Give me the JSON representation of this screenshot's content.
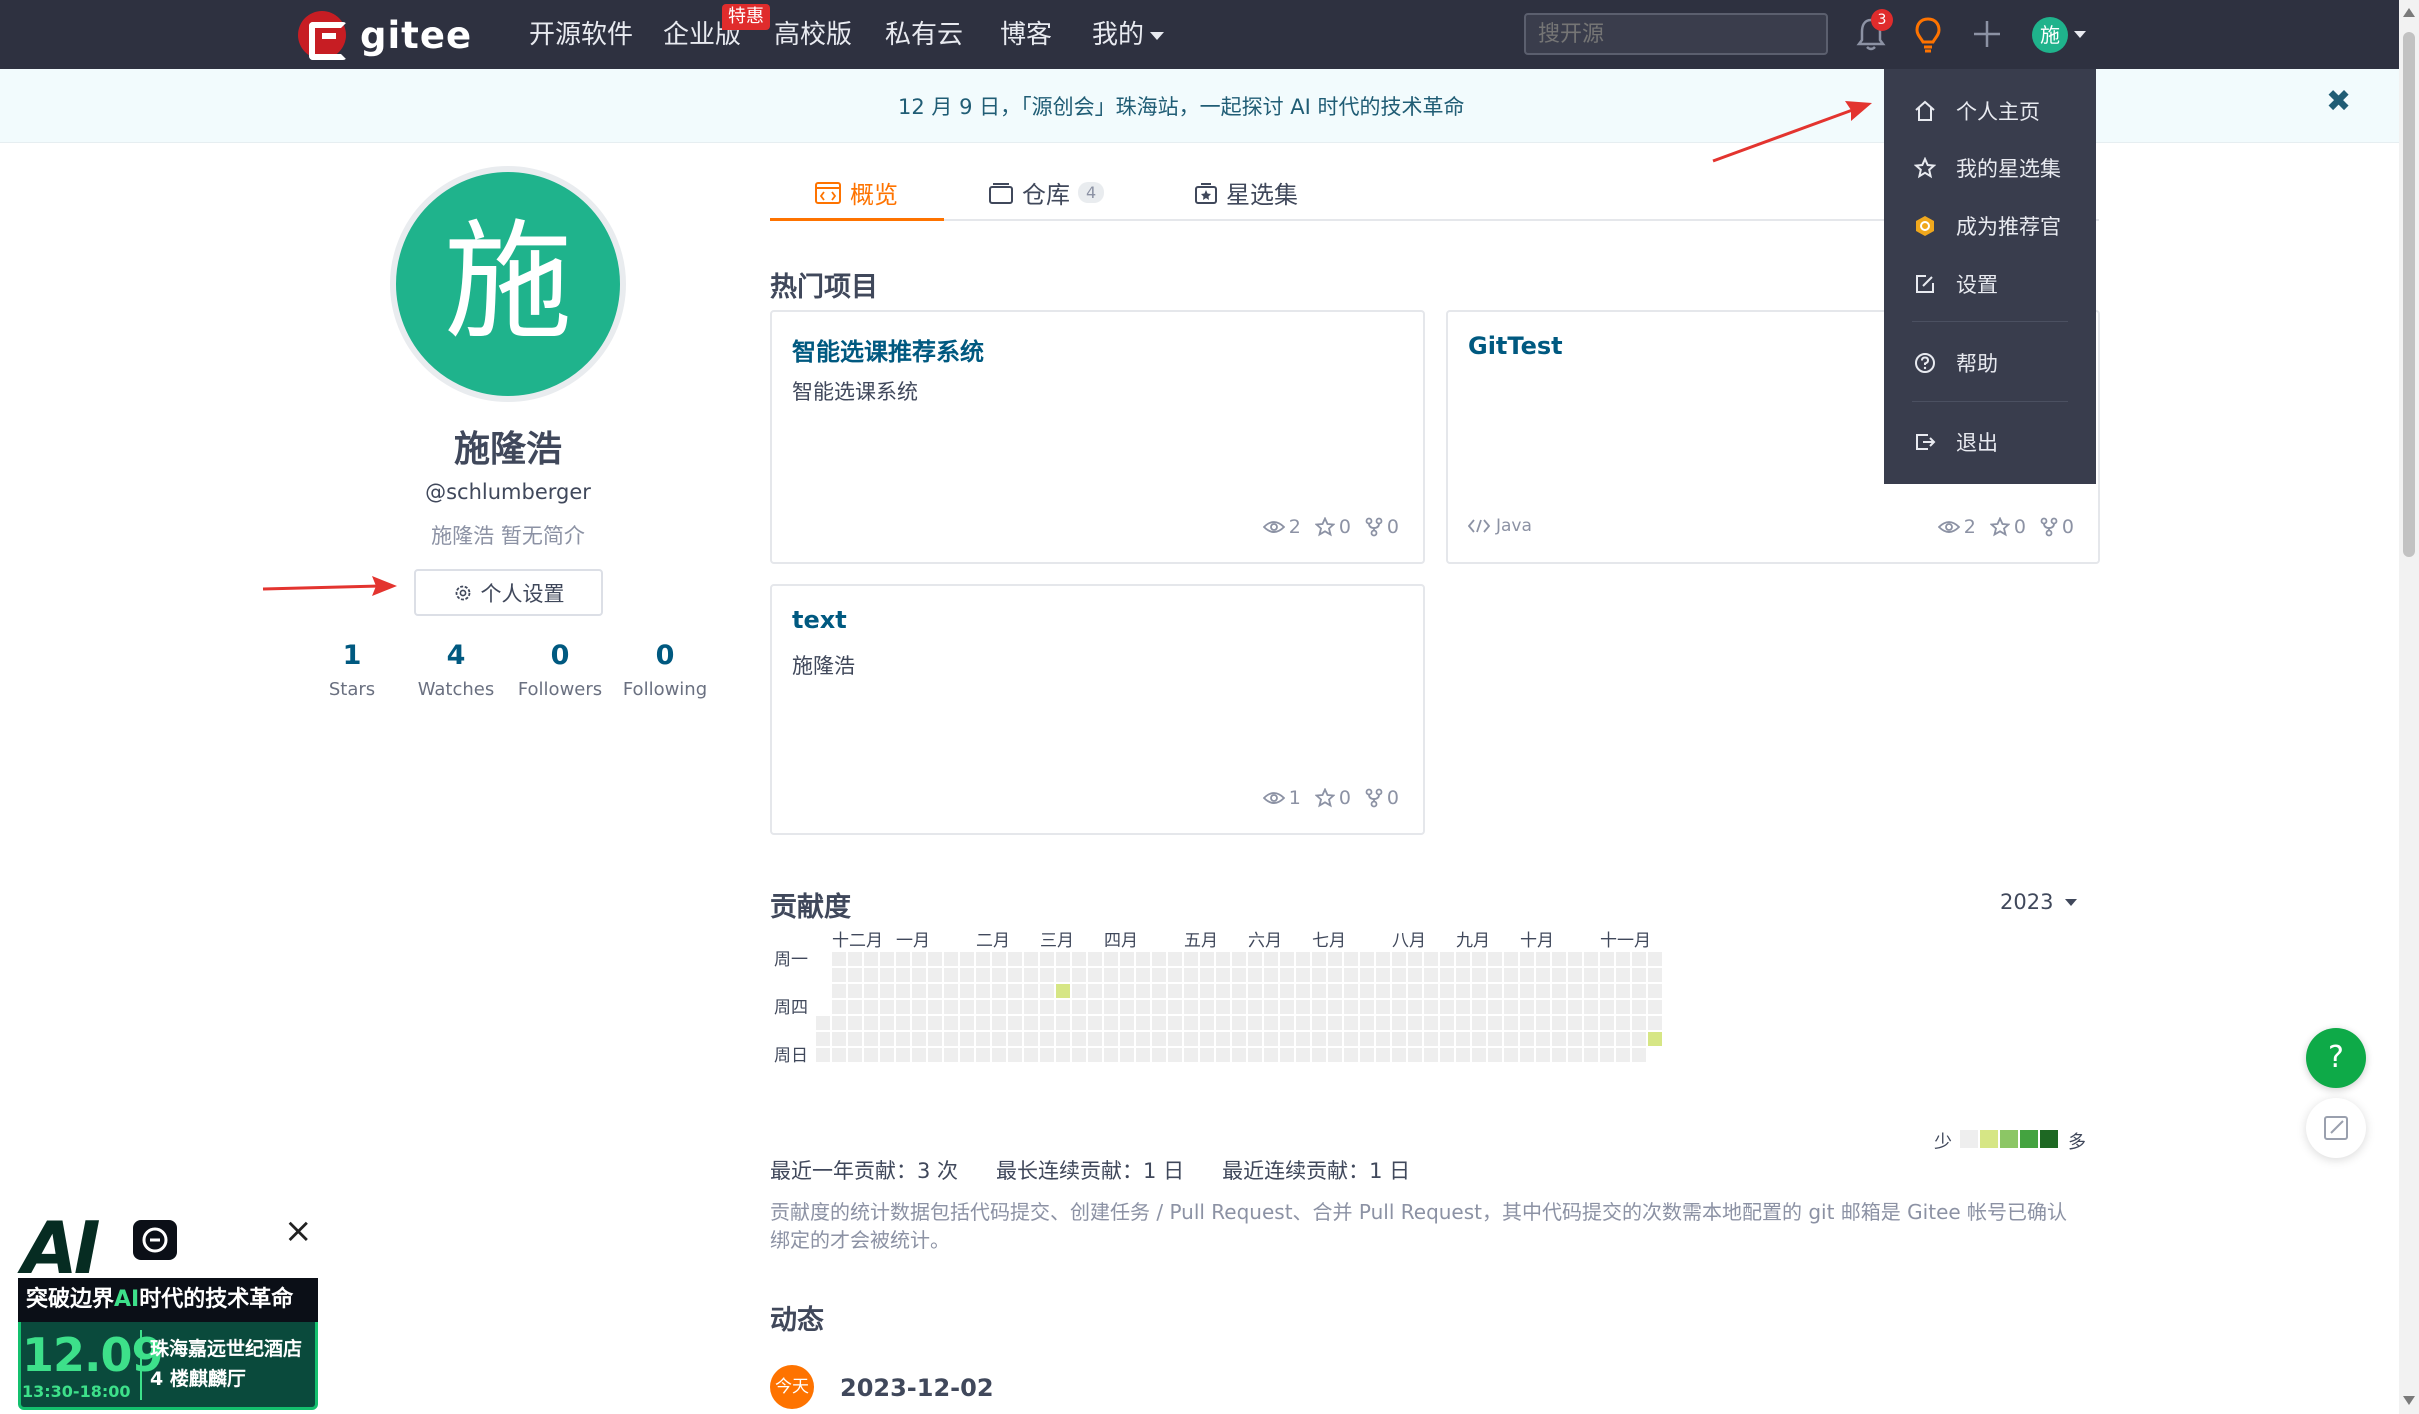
{
  "nav": {
    "logo_text": "gitee",
    "items": [
      {
        "label": "开源软件"
      },
      {
        "label": "企业版",
        "badge": "特惠"
      },
      {
        "label": "高校版"
      },
      {
        "label": "私有云"
      },
      {
        "label": "博客"
      },
      {
        "label": "我的"
      }
    ],
    "search_placeholder": "搜开源",
    "notification_count": "3",
    "avatar_char": "施"
  },
  "banner": {
    "text": "12 月 9 日，「源创会」珠海站，一起探讨 AI 时代的技术革命",
    "close": "✖"
  },
  "profile": {
    "avatar_char": "施",
    "name": "施隆浩",
    "login": "@schlumberger",
    "bio": "施隆浩 暂无简介",
    "settings_button": "个人设置",
    "stats": [
      {
        "value": "1",
        "label": "Stars"
      },
      {
        "value": "4",
        "label": "Watches"
      },
      {
        "value": "0",
        "label": "Followers"
      },
      {
        "value": "0",
        "label": "Following"
      }
    ]
  },
  "tabs": [
    {
      "label": "概览",
      "active": true
    },
    {
      "label": "仓库",
      "count": "4"
    },
    {
      "label": "星选集"
    }
  ],
  "hot_projects": {
    "title": "热门项目",
    "cards": [
      {
        "name": "智能选课推荐系统",
        "desc": "智能选课系统",
        "lang": "",
        "watches": "2",
        "stars": "0",
        "forks": "0"
      },
      {
        "name": "GitTest",
        "desc": "",
        "lang": "Java",
        "watches": "2",
        "stars": "0",
        "forks": "0"
      },
      {
        "name": "text",
        "desc": "施隆浩",
        "lang": "",
        "watches": "1",
        "stars": "0",
        "forks": "0"
      }
    ]
  },
  "contribution": {
    "title": "贡献度",
    "year": "2023",
    "months": [
      "十二月",
      "一月",
      "二月",
      "三月",
      "四月",
      "五月",
      "六月",
      "七月",
      "八月",
      "九月",
      "十月",
      "十一月"
    ],
    "weekdays": [
      "周一",
      "周四",
      "周日"
    ],
    "legend_less": "少",
    "legend_more": "多",
    "legend_colors": [
      "#eeeeee",
      "#d6e685",
      "#8cc665",
      "#44a340",
      "#1e6823"
    ],
    "empty_color": "#eeeeee",
    "active_cells": [
      {
        "week": 15,
        "day": 2,
        "level": 1
      },
      {
        "week": 52,
        "day": 5,
        "level": 1
      }
    ],
    "summary": [
      "最近一年贡献：3 次",
      "最长连续贡献：1 日",
      "最近连续贡献：1 日"
    ],
    "note": "贡献度的统计数据包括代码提交、创建任务 / Pull Request、合并 Pull Request，其中代码提交的次数需本地配置的 git 邮箱是 Gitee 帐号已确认绑定的才会被统计。"
  },
  "activity": {
    "title": "动态",
    "today_label": "今天",
    "date": "2023-12-02"
  },
  "user_menu": [
    {
      "label": "个人主页",
      "icon": "home-icon"
    },
    {
      "label": "我的星选集",
      "icon": "star-icon"
    },
    {
      "label": "成为推荐官",
      "icon": "gitee-coin-icon"
    },
    {
      "label": "设置",
      "icon": "edit-icon"
    },
    {
      "label": "帮助",
      "icon": "help-circle-icon"
    },
    {
      "label": "退出",
      "icon": "logout-icon"
    }
  ],
  "float_help": "?",
  "ad": {
    "ai": "AI",
    "headline_pre": "突破边界",
    "headline_ai": "AI",
    "headline_post": "时代的技术革命",
    "date": "12.09",
    "time": "13:30-18:00",
    "place_1": "珠海嘉远世纪酒店",
    "place_2": "4 楼麒麟厅"
  },
  "colors": {
    "nav_bg": "#2e3140",
    "accent": "#fe7300",
    "link": "#005980",
    "avatar": "#1fb38c",
    "annotation_arrow": "#e3342f"
  }
}
